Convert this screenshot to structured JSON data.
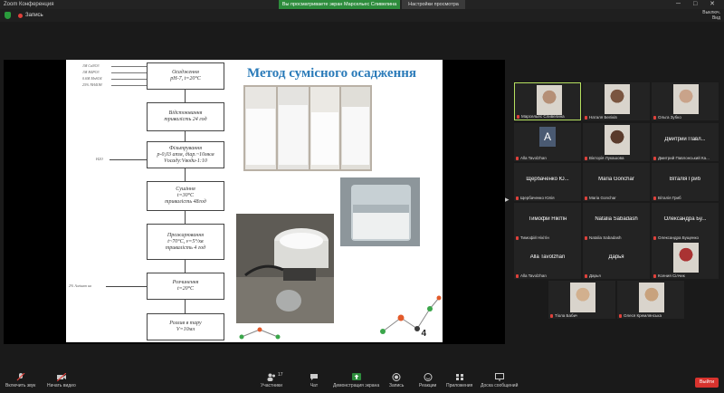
{
  "window": {
    "title": "Zoom Конференция",
    "share_bar": "Вы просматриваете экран Марсельес Сливелина",
    "view_options": "Настройки просмотра",
    "controls": "─ □ ✕"
  },
  "topbar": {
    "recording": "Запись",
    "view_label": "Вид",
    "view_top": "Выключ."
  },
  "slide": {
    "title": "Метод сумісного осадження",
    "page": "4",
    "flow": [
      {
        "text": "Осадження\npH-7, t=20°С"
      },
      {
        "text": "Відстоювання\nтривалість 24 год"
      },
      {
        "text": "Фільтрування\nр-0,03 атм, діар.~10мкм\nVосаду:Vводи-1:10"
      },
      {
        "text": "Сушіння\nt=30°С\nтривалість 48год"
      },
      {
        "text": "Прожарювання\nt~70°С, v=5°/хв\nтривалість 4 год"
      },
      {
        "text": "Розчинення\nt=20°С"
      },
      {
        "text": "Розлив в тару\nV=10мл"
      }
    ],
    "inputs": [
      "1М CaNO3",
      "1М Н4РО3",
      "0.6М MnSO4",
      "25% NH4OH"
    ],
    "side_inputs": [
      "H2O",
      "2% Алгінат на"
    ]
  },
  "participants": [
    {
      "name": "",
      "label": "Марсельес Сливелина",
      "kind": "video",
      "active": true
    },
    {
      "name": "",
      "label": "Наталя Беліків",
      "kind": "video"
    },
    {
      "name": "",
      "label": "Ольга Зубко",
      "kind": "video"
    },
    {
      "name": "",
      "label": "Alla Tavolzhan",
      "kind": "avatar",
      "initial": "A"
    },
    {
      "name": "",
      "label": "Вікторія Лукашова",
      "kind": "video"
    },
    {
      "name": "Дмитрий Павл...",
      "label": "Дмитрий Павлонський Ка...",
      "kind": "text"
    },
    {
      "name": "Щербаченко Ю...",
      "label": "Щербаченко Юлія",
      "kind": "text"
    },
    {
      "name": "Maria Gonchar",
      "label": "Maria Gonchar",
      "kind": "text"
    },
    {
      "name": "Віталія Гриб",
      "label": "Віталія Гриб",
      "kind": "text"
    },
    {
      "name": "Тимофій Нікітін",
      "label": "Тимофій Нікітін",
      "kind": "text"
    },
    {
      "name": "Natalia Sabadash",
      "label": "Natalia Sabadash",
      "kind": "text"
    },
    {
      "name": "Олександра Бу...",
      "label": "Олександра Бущенко",
      "kind": "text"
    },
    {
      "name": "Alla Tavolzhan",
      "label": "Alla Tavolzhan",
      "kind": "text"
    },
    {
      "name": "Дарья",
      "label": "Дарья",
      "kind": "text"
    },
    {
      "name": "",
      "label": "Ксения Сілчик",
      "kind": "video"
    },
    {
      "name": "",
      "label": "Тіола Бабич",
      "kind": "video"
    },
    {
      "name": "",
      "label": "Олеся Кремлянська",
      "kind": "video"
    }
  ],
  "toolbar": {
    "mute": "Включить звук",
    "video": "Начать видео",
    "participants": "Участники",
    "participants_count": "17",
    "chat": "Чат",
    "share": "Демонстрация экрана",
    "record": "Запись",
    "reactions": "Реакции",
    "apps": "Приложения",
    "whiteboard": "Доска сообщений",
    "end": "Выйти"
  },
  "colors": {
    "share_green": "#2d8c3c",
    "end_red": "#d8332e",
    "active_border": "#b6e060",
    "slide_title": "#2b7bb9"
  }
}
